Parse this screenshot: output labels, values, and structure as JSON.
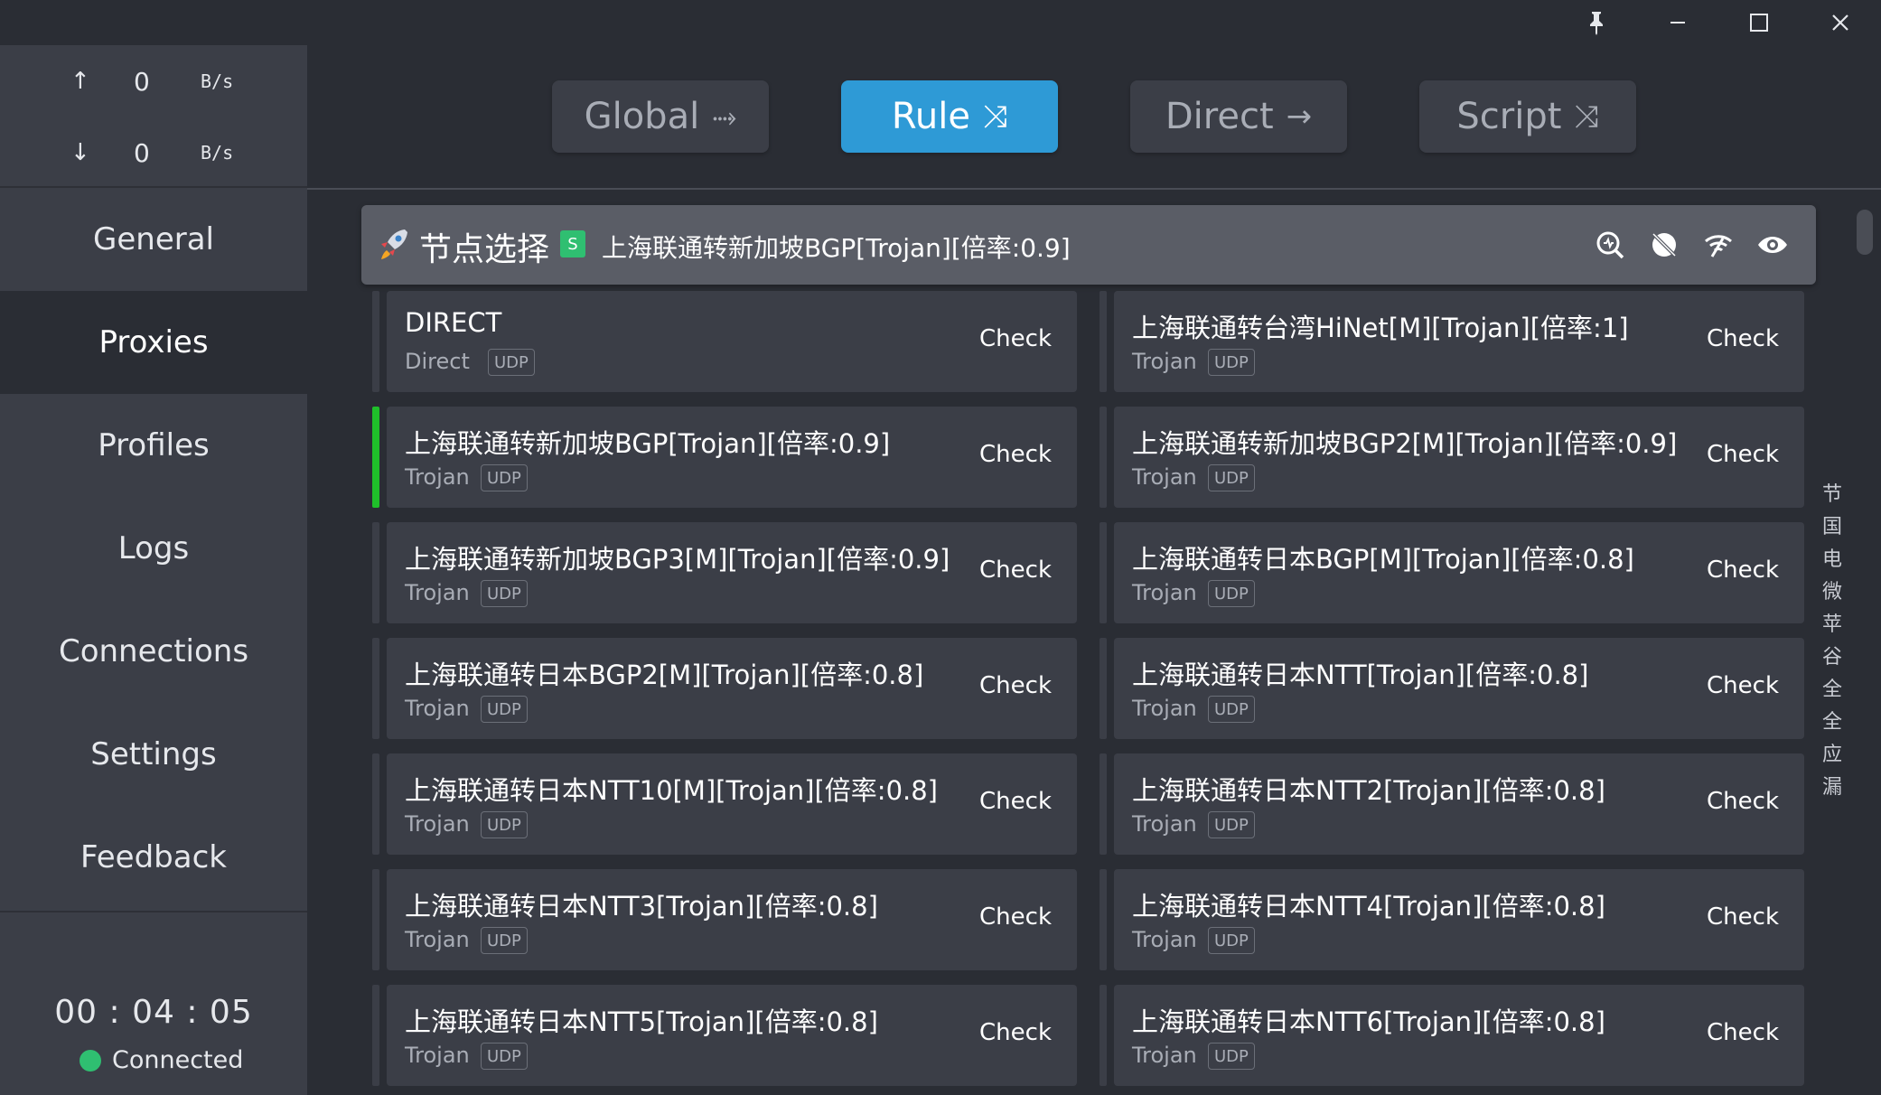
{
  "window": {
    "pin_icon": "pin-icon",
    "minimize_icon": "minimize-icon",
    "maximize_icon": "maximize-icon",
    "close_icon": "close-icon"
  },
  "traffic": {
    "up_arrow": "↑",
    "up_value": "0",
    "up_unit": "B/s",
    "down_arrow": "↓",
    "down_value": "0",
    "down_unit": "B/s"
  },
  "nav": {
    "items": [
      {
        "label": "General"
      },
      {
        "label": "Proxies"
      },
      {
        "label": "Profiles"
      },
      {
        "label": "Logs"
      },
      {
        "label": "Connections"
      },
      {
        "label": "Settings"
      },
      {
        "label": "Feedback"
      }
    ],
    "active": "Proxies"
  },
  "footer": {
    "uptime": "00 : 04 : 05",
    "status": "Connected",
    "status_color": "#2fbf71"
  },
  "modes": [
    {
      "label": "Global",
      "icon": "⤑"
    },
    {
      "label": "Rule",
      "icon": "⤨"
    },
    {
      "label": "Direct",
      "icon": "→"
    },
    {
      "label": "Script",
      "icon": "⤨"
    }
  ],
  "active_mode": "Rule",
  "group": {
    "name": "节点选择",
    "badge": "S",
    "selected": "上海联通转新加坡BGP[Trojan][倍率:0.9]",
    "icons": [
      "rocket-icon",
      "latency-search-icon",
      "hide-icon",
      "wifi-icon",
      "eye-icon"
    ]
  },
  "proxies": [
    {
      "name": "DIRECT",
      "type": "Direct",
      "udp": "UDP",
      "check": "Check"
    },
    {
      "name": "上海联通转台湾HiNet[M][Trojan][倍率:1]",
      "type": "Trojan",
      "udp": "UDP",
      "check": "Check"
    },
    {
      "name": "上海联通转新加坡BGP[Trojan][倍率:0.9]",
      "type": "Trojan",
      "udp": "UDP",
      "check": "Check"
    },
    {
      "name": "上海联通转新加坡BGP2[M][Trojan][倍率:0.9]",
      "type": "Trojan",
      "udp": "UDP",
      "check": "Check"
    },
    {
      "name": "上海联通转新加坡BGP3[M][Trojan][倍率:0.9]",
      "type": "Trojan",
      "udp": "UDP",
      "check": "Check"
    },
    {
      "name": "上海联通转日本BGP[M][Trojan][倍率:0.8]",
      "type": "Trojan",
      "udp": "UDP",
      "check": "Check"
    },
    {
      "name": "上海联通转日本BGP2[M][Trojan][倍率:0.8]",
      "type": "Trojan",
      "udp": "UDP",
      "check": "Check"
    },
    {
      "name": "上海联通转日本NTT[Trojan][倍率:0.8]",
      "type": "Trojan",
      "udp": "UDP",
      "check": "Check"
    },
    {
      "name": "上海联通转日本NTT10[M][Trojan][倍率:0.8]",
      "type": "Trojan",
      "udp": "UDP",
      "check": "Check"
    },
    {
      "name": "上海联通转日本NTT2[Trojan][倍率:0.8]",
      "type": "Trojan",
      "udp": "UDP",
      "check": "Check"
    },
    {
      "name": "上海联通转日本NTT3[Trojan][倍率:0.8]",
      "type": "Trojan",
      "udp": "UDP",
      "check": "Check"
    },
    {
      "name": "上海联通转日本NTT4[Trojan][倍率:0.8]",
      "type": "Trojan",
      "udp": "UDP",
      "check": "Check"
    },
    {
      "name": "上海联通转日本NTT5[Trojan][倍率:0.8]",
      "type": "Trojan",
      "udp": "UDP",
      "check": "Check"
    },
    {
      "name": "上海联通转日本NTT6[Trojan][倍率:0.8]",
      "type": "Trojan",
      "udp": "UDP",
      "check": "Check"
    }
  ],
  "index_letters": [
    "节",
    "国",
    "电",
    "微",
    "苹",
    "谷",
    "全",
    "全",
    "应",
    "漏"
  ]
}
